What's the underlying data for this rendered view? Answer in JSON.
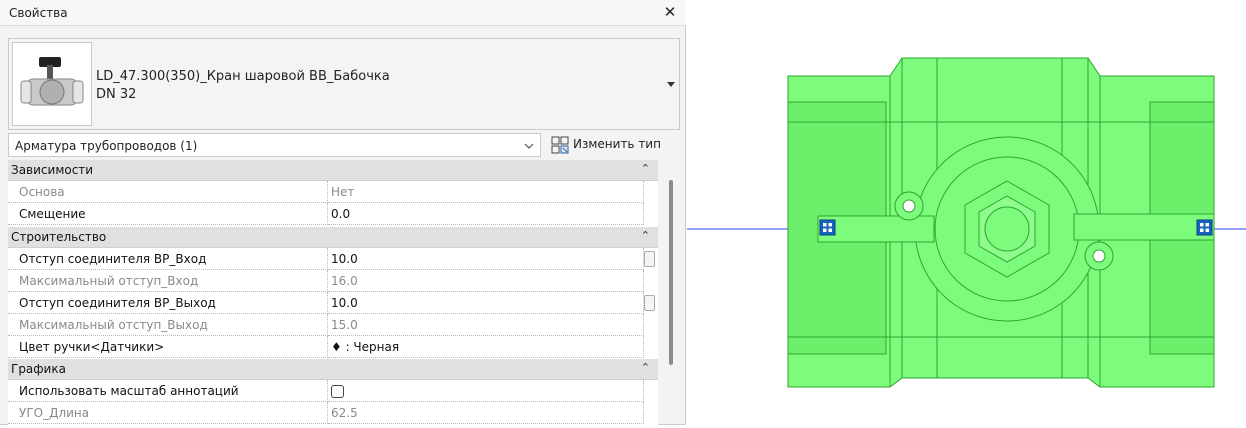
{
  "panel": {
    "title": "Свойства",
    "close_glyph": "✕"
  },
  "type_selector": {
    "name": "LD_47.300(350)_Кран шаровой ВВ_Бабочка",
    "size": "DN 32",
    "thumbnail_icon": "ball-valve-icon"
  },
  "category": {
    "label": "Арматура трубопроводов (1)"
  },
  "edit_type": {
    "label": "Изменить тип",
    "icon": "edit-type-icon"
  },
  "groups": [
    {
      "title": "Зависимости",
      "toggle": "⌃",
      "rows": [
        {
          "name": "Основа",
          "value": "Нет",
          "readonly": true
        },
        {
          "name": "Смещение",
          "value": "0.0",
          "readonly": false
        }
      ]
    },
    {
      "title": "Строительство",
      "toggle": "⌃",
      "rows": [
        {
          "name": "Отступ соединителя ВР_Вход",
          "value": "10.0",
          "readonly": false
        },
        {
          "name": "Максимальный отступ_Вход",
          "value": "16.0",
          "readonly": true
        },
        {
          "name": "Отступ соединителя ВР_Выход",
          "value": "10.0",
          "readonly": false
        },
        {
          "name": "Максимальный отступ_Выход",
          "value": "15.0",
          "readonly": true
        },
        {
          "name": "Цвет ручки<Датчики>",
          "value": "♦ : Черная",
          "readonly": false
        }
      ]
    },
    {
      "title": "Графика",
      "toggle": "⌃",
      "rows": [
        {
          "name": "Использовать масштаб аннотаций",
          "value": "",
          "checkbox": false,
          "readonly": false
        },
        {
          "name": "УГО_Длина",
          "value": "62.5",
          "readonly": true
        }
      ]
    }
  ],
  "colors": {
    "valve_fill": "#7dfb7d",
    "valve_stroke": "#2fa52f",
    "pipe_line": "#2b3ff0",
    "connector_fill": "#1565c0"
  }
}
